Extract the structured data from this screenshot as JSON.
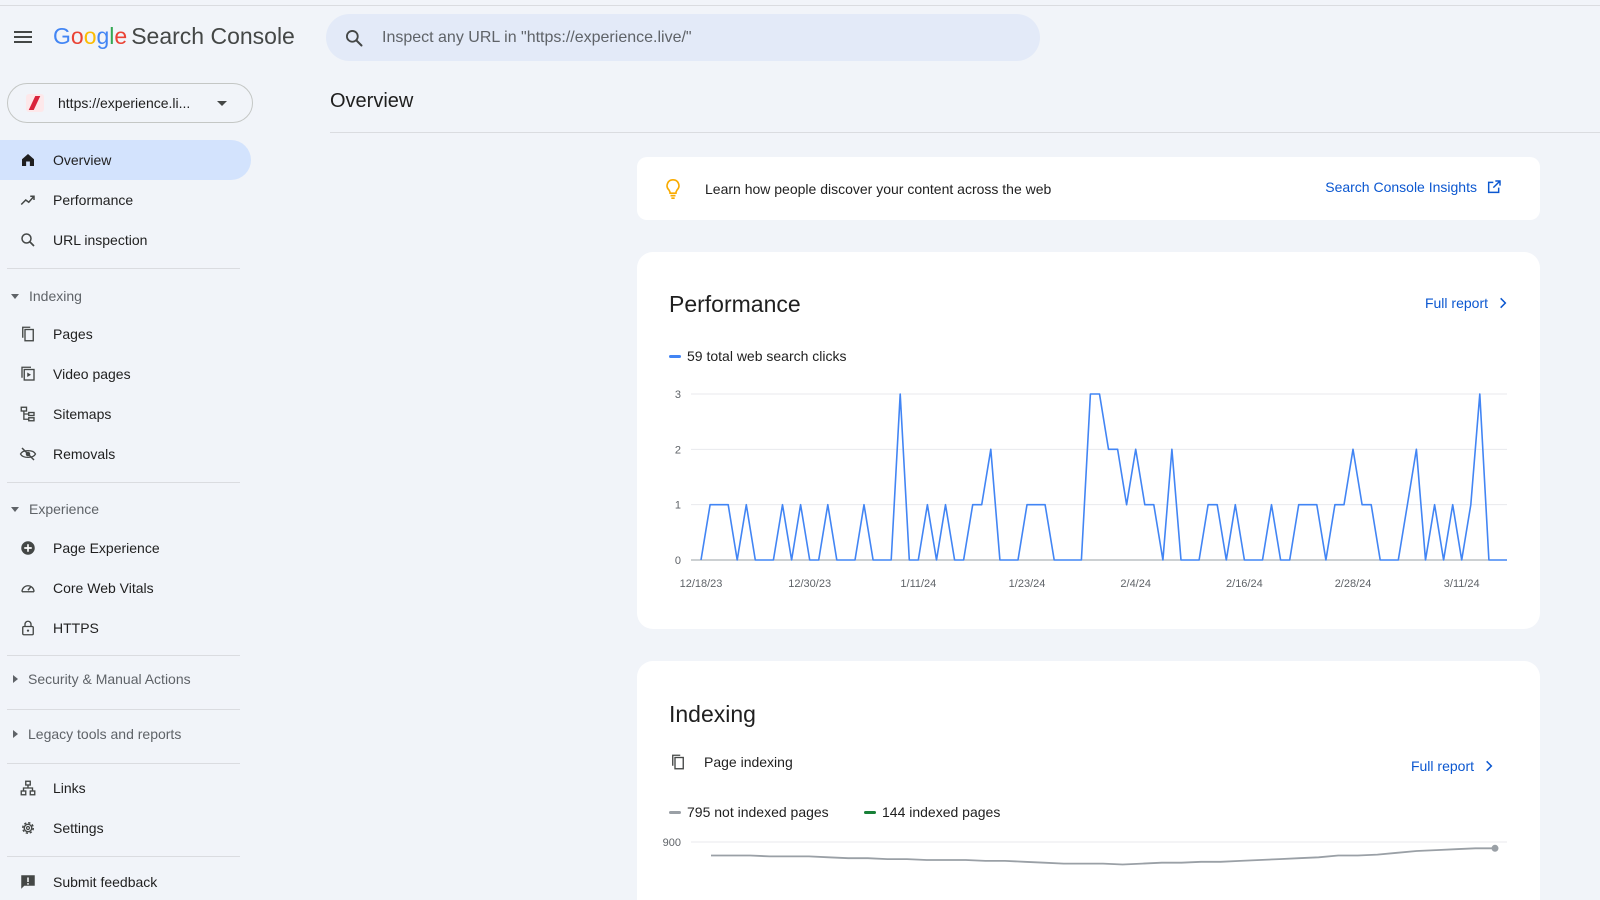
{
  "header": {
    "logo_letters": [
      "G",
      "o",
      "o",
      "g",
      "l",
      "e"
    ],
    "product": "Search Console",
    "search_placeholder": "Inspect any URL in \"https://experience.live/\""
  },
  "sidebar": {
    "property_label": "https://experience.li...",
    "items": {
      "overview": "Overview",
      "performance": "Performance",
      "url_inspection": "URL inspection",
      "pages": "Pages",
      "video_pages": "Video pages",
      "sitemaps": "Sitemaps",
      "removals": "Removals",
      "page_experience": "Page Experience",
      "core_web_vitals": "Core Web Vitals",
      "https": "HTTPS",
      "links": "Links",
      "settings": "Settings",
      "submit_feedback": "Submit feedback"
    },
    "sections": {
      "indexing": "Indexing",
      "experience": "Experience",
      "security": "Security & Manual Actions",
      "legacy": "Legacy tools and reports"
    }
  },
  "main": {
    "title": "Overview",
    "insights": {
      "text": "Learn how people discover your content across the web",
      "link": "Search Console Insights"
    },
    "performance": {
      "title": "Performance",
      "full_report": "Full report",
      "legend": "59 total web search clicks"
    },
    "indexing": {
      "title": "Indexing",
      "subtitle": "Page indexing",
      "full_report": "Full report",
      "legend_not_indexed": "795 not indexed pages",
      "legend_indexed": "144 indexed pages"
    }
  },
  "colors": {
    "accent": "#0b57d0",
    "clicks_series": "#4285f4",
    "not_indexed": "#9aa0a6",
    "indexed": "#188038",
    "active_nav": "#d3e3fd"
  },
  "chart_data": [
    {
      "type": "line",
      "legend": "59 total web search clicks",
      "series": [
        {
          "name": "59 total web search clicks",
          "values": [
            0,
            1,
            1,
            1,
            0,
            1,
            0,
            0,
            0,
            1,
            0,
            1,
            0,
            0,
            1,
            0,
            0,
            0,
            1,
            0,
            0,
            0,
            3,
            0,
            0,
            1,
            0,
            1,
            0,
            0,
            1,
            1,
            2,
            0,
            0,
            0,
            1,
            1,
            1,
            0,
            0,
            0,
            0,
            3,
            3,
            2,
            2,
            1,
            2,
            1,
            1,
            0,
            2,
            0,
            0,
            0,
            1,
            1,
            0,
            1,
            0,
            0,
            0,
            1,
            0,
            0,
            1,
            1,
            1,
            0,
            1,
            1,
            2,
            1,
            1,
            0,
            0,
            0,
            1,
            2,
            0,
            1,
            0,
            1,
            0,
            1,
            3,
            0,
            0,
            0
          ]
        }
      ],
      "x_tick_labels": [
        "12/18/23",
        "12/30/23",
        "1/11/24",
        "1/23/24",
        "2/4/24",
        "2/16/24",
        "2/28/24",
        "3/11/24"
      ],
      "x_tick_index": [
        0,
        12,
        24,
        36,
        48,
        60,
        72,
        84
      ],
      "y_ticks": [
        0,
        1,
        2,
        3
      ],
      "ylim": [
        0,
        3
      ],
      "grid": true
    },
    {
      "type": "line",
      "y_ticks": [
        900
      ],
      "series": [
        {
          "name": "795 not indexed pages",
          "values": [
            885,
            885,
            885,
            884,
            884,
            884,
            883,
            882,
            882,
            881,
            881,
            880,
            880,
            880,
            879,
            879,
            878,
            877,
            876,
            876,
            876,
            875,
            876,
            877,
            877,
            878,
            878,
            879,
            880,
            881,
            882,
            883,
            885,
            885,
            886,
            888,
            890,
            891,
            892,
            893,
            893
          ]
        }
      ],
      "grid": true
    }
  ]
}
